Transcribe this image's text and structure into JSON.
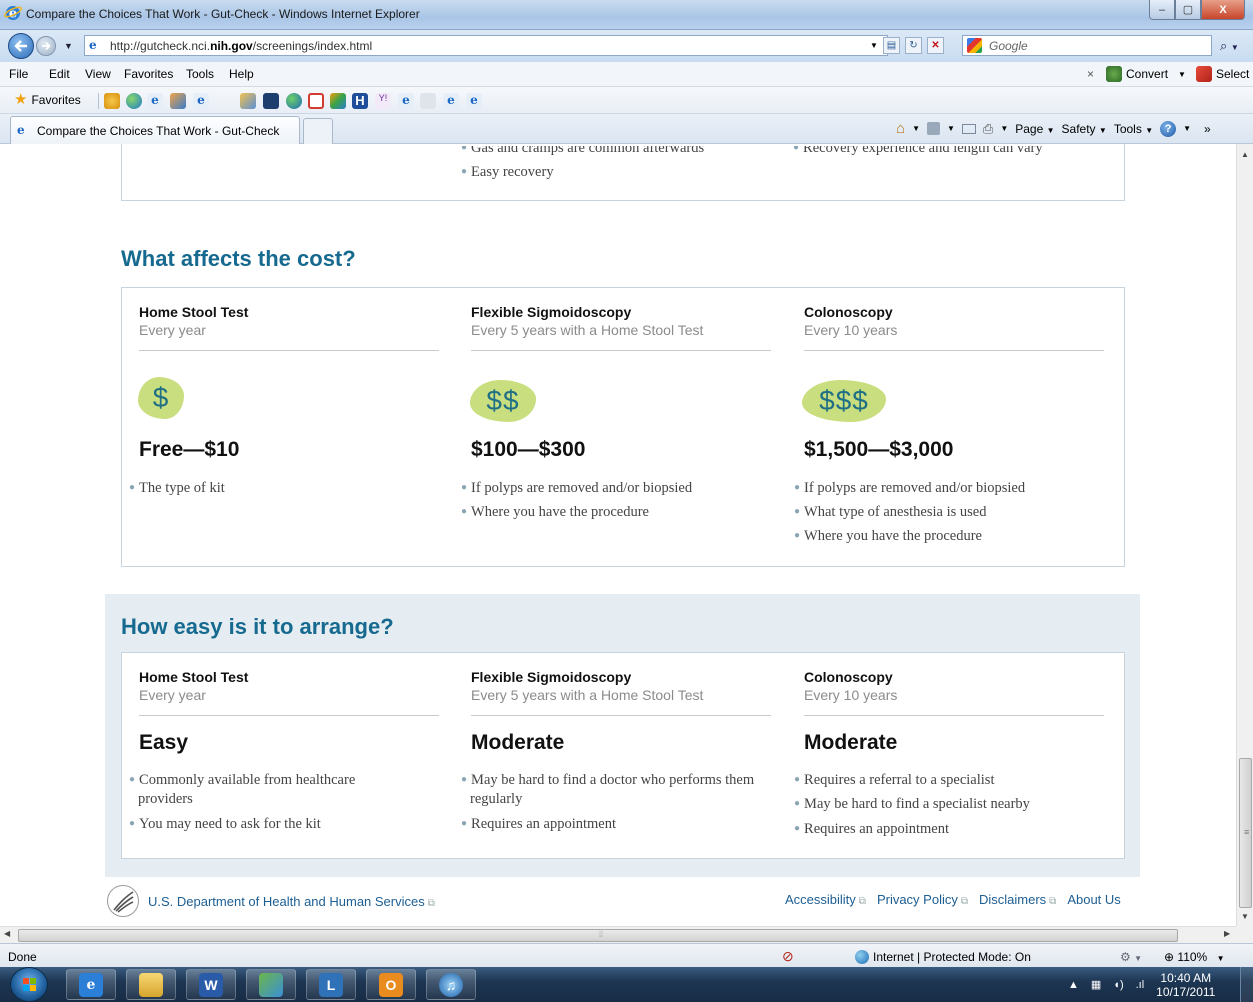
{
  "window": {
    "title": "Compare the Choices That Work - Gut-Check - Windows Internet Explorer",
    "minimize": "–",
    "maximize": "▢",
    "close": "X"
  },
  "address_bar": {
    "url_prefix": "http://gutcheck.nci.",
    "url_domain": "nih.gov",
    "url_path": "/screenings/index.html",
    "search_placeholder": "Google",
    "page_icon": "e",
    "refresh_icon": "refresh-icon",
    "stop_icon": "stop-icon"
  },
  "menu_bar": {
    "items": [
      "File",
      "Edit",
      "View",
      "Favorites",
      "Tools",
      "Help"
    ],
    "close": "×",
    "convert": "Convert",
    "select": "Select"
  },
  "favorites_bar": {
    "label": "Favorites"
  },
  "tab_bar": {
    "active_tab": "Compare the Choices That Work - Gut-Check",
    "commands": [
      "Page",
      "Safety",
      "Tools"
    ],
    "more": "»"
  },
  "content": {
    "prev_section": {
      "partial_left": "Gas and cramps are common afterwards",
      "partial_right": "Recovery experience and length can vary",
      "bullet": "Easy recovery"
    },
    "cost_section": {
      "title": "What affects the cost?",
      "columns": [
        {
          "name": "Home Stool Test",
          "frequency": "Every year",
          "badge": "$",
          "price": "Free—$10",
          "bullets": [
            "The type of kit"
          ]
        },
        {
          "name": "Flexible Sigmoidoscopy",
          "frequency": "Every 5 years with a Home Stool Test",
          "badge": "$$",
          "price": "$100—$300",
          "bullets": [
            "If polyps are removed and/or biopsied",
            "Where you have the procedure"
          ]
        },
        {
          "name": "Colonoscopy",
          "frequency": "Every 10 years",
          "badge": "$$$",
          "price": "$1,500—$3,000",
          "bullets": [
            "If polyps are removed and/or biopsied",
            "What type of anesthesia is used",
            "Where you have the procedure"
          ]
        }
      ]
    },
    "arrange_section": {
      "title": "How easy is it to arrange?",
      "columns": [
        {
          "name": "Home Stool Test",
          "frequency": "Every year",
          "rating": "Easy",
          "bullets": [
            "Commonly available from healthcare providers",
            "You may need to ask for the kit"
          ]
        },
        {
          "name": "Flexible Sigmoidoscopy",
          "frequency": "Every 5 years with a Home Stool Test",
          "rating": "Moderate",
          "bullets": [
            "May be hard to find a doctor who performs them regularly",
            "Requires an appointment"
          ]
        },
        {
          "name": "Colonoscopy",
          "frequency": "Every 10 years",
          "rating": "Moderate",
          "bullets": [
            "Requires a referral to a specialist",
            "May be hard to find a specialist nearby",
            "Requires an appointment"
          ]
        }
      ]
    },
    "footer": {
      "hhs_link": "U.S. Department of Health and Human Services",
      "links": [
        "Accessibility",
        "Privacy Policy",
        "Disclaimers",
        "About Us"
      ]
    }
  },
  "status_bar": {
    "status": "Done",
    "zone": "Internet | Protected Mode: On",
    "zoom": "110%"
  },
  "taskbar": {
    "time": "10:40 AM",
    "date": "10/17/2011"
  },
  "colors": {
    "section_title": "#176a8f",
    "badge": "#c9de7e",
    "badge_text": "#1f6f85",
    "panel": "#e6edf2",
    "link": "#1d5e93"
  }
}
